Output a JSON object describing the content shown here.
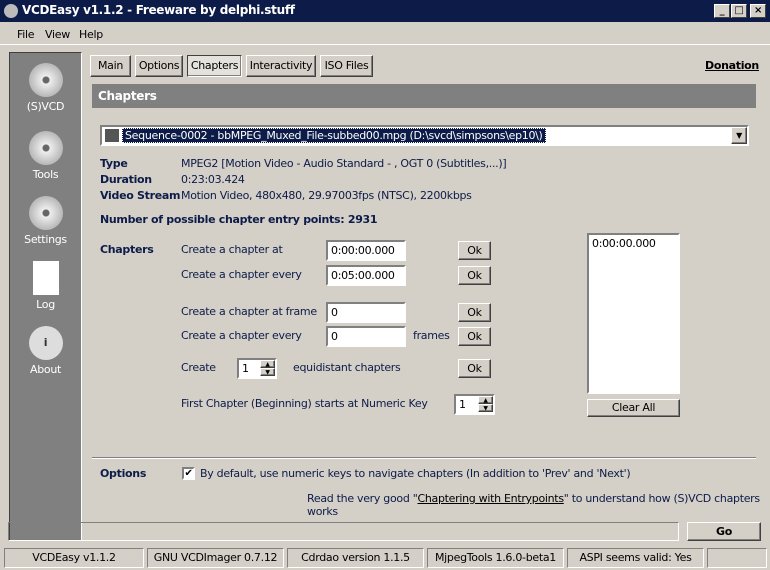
{
  "window": {
    "title": "VCDEasy v1.1.2 - Freeware by delphi.stuff"
  },
  "menu": [
    "File",
    "View",
    "Help"
  ],
  "sidebar": [
    {
      "label": "(S)VCD",
      "icon": "svcd-disc-icon"
    },
    {
      "label": "Tools",
      "icon": "tools-icon"
    },
    {
      "label": "Settings",
      "icon": "settings-icon"
    },
    {
      "label": "Log",
      "icon": "log-icon"
    },
    {
      "label": "About",
      "icon": "about-icon"
    }
  ],
  "tabs": [
    "Main",
    "Options",
    "Chapters",
    "Interactivity",
    "ISO Files"
  ],
  "donation": "Donation",
  "section_title": "Chapters",
  "file_combo": "Sequence-0002 - bbMPEG_Muxed_File-subbed00.mpg  (D:\\svcd\\simpsons\\ep10\\)",
  "info": {
    "type_label": "Type",
    "type_value": "MPEG2   [Motion Video - Audio Standard - , OGT 0 (Subtitles,...)]",
    "duration_label": "Duration",
    "duration_value": "0:23:03.424",
    "stream_label": "Video Stream",
    "stream_value": "Motion Video, 480x480, 29.97003fps (NTSC), 2200kbps",
    "entry_points": "Number of possible chapter entry points: 2931"
  },
  "chapters": {
    "label": "Chapters",
    "at_label": "Create a chapter at",
    "at_value": "0:00:00.000",
    "every_label": "Create a chapter every",
    "every_value": "0:05:00.000",
    "frame_label": "Create a chapter at frame",
    "frame_value": "0",
    "every_frames_label": "Create a chapter every",
    "every_frames_value": "0",
    "frames_unit": "frames",
    "create_label": "Create",
    "create_value": "1",
    "equidistant_label": "equidistant chapters",
    "first_label": "First Chapter (Beginning) starts at Numeric Key",
    "first_value": "1",
    "ok": "Ok",
    "list": [
      "0:00:00.000"
    ],
    "clear_all": "Clear All"
  },
  "options": {
    "label": "Options",
    "checkbox_label": "By default, use numeric keys to navigate chapters (In addition to 'Prev' and 'Next')",
    "checked": true,
    "read_pre": "Read the very good \"",
    "read_link": "Chaptering with Entrypoints",
    "read_post": "\" to understand how (S)VCD chapters works"
  },
  "go": "Go",
  "statusbar": [
    "VCDEasy v1.1.2",
    "GNU VCDImager 0.7.12",
    "Cdrdao version 1.1.5",
    "MjpegTools 1.6.0-beta1",
    "ASPI seems valid: Yes"
  ]
}
